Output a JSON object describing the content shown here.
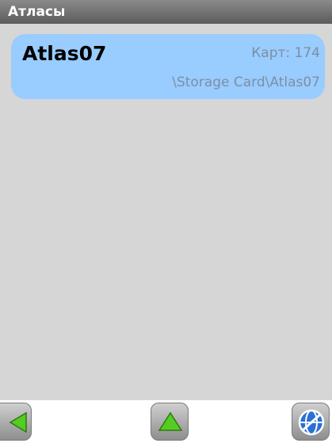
{
  "window": {
    "title": "Атласы"
  },
  "atlases": [
    {
      "name": "Atlas07",
      "count": "Карт: 174",
      "path": "\\Storage Card\\Atlas07"
    }
  ],
  "toolbar": {
    "back_icon": "arrow-left-icon",
    "up_icon": "arrow-up-icon",
    "globe_icon": "globe-icon",
    "accent_color": "#55cc22"
  }
}
